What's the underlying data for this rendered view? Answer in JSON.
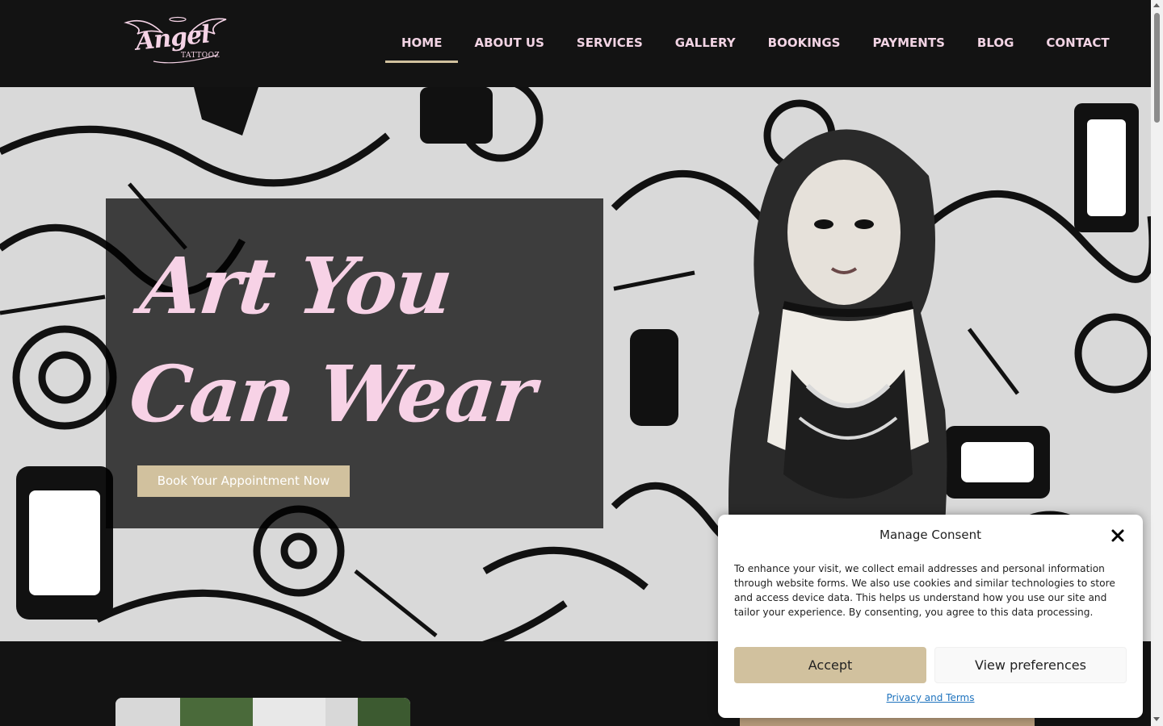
{
  "brand": {
    "logo_name": "Angel",
    "logo_sub": "TATTOOZ",
    "colors": {
      "accent_gold": "#d1c19e",
      "accent_pink": "#f7d2e6",
      "header_bg": "#131313"
    }
  },
  "nav": {
    "items": [
      {
        "label": "HOME",
        "active": true
      },
      {
        "label": "ABOUT US"
      },
      {
        "label": "SERVICES"
      },
      {
        "label": "GALLERY"
      },
      {
        "label": "BOOKINGS"
      },
      {
        "label": "PAYMENTS"
      },
      {
        "label": "BLOG"
      },
      {
        "label": "CONTACT"
      }
    ]
  },
  "hero": {
    "title_line1": "Art You",
    "title_line2": "Can Wear",
    "cta_label": "Book Your Appointment Now"
  },
  "consent": {
    "title": "Manage Consent",
    "close_icon": "close-icon",
    "text": "To enhance your visit, we collect email addresses and personal information through website forms. We also use cookies and similar technologies to store and access device data. This helps us understand how you use our site and tailor your experience. By consenting, you agree to this data processing.",
    "accept_label": "Accept",
    "preferences_label": "View preferences",
    "privacy_label": "Privacy and Terms"
  }
}
